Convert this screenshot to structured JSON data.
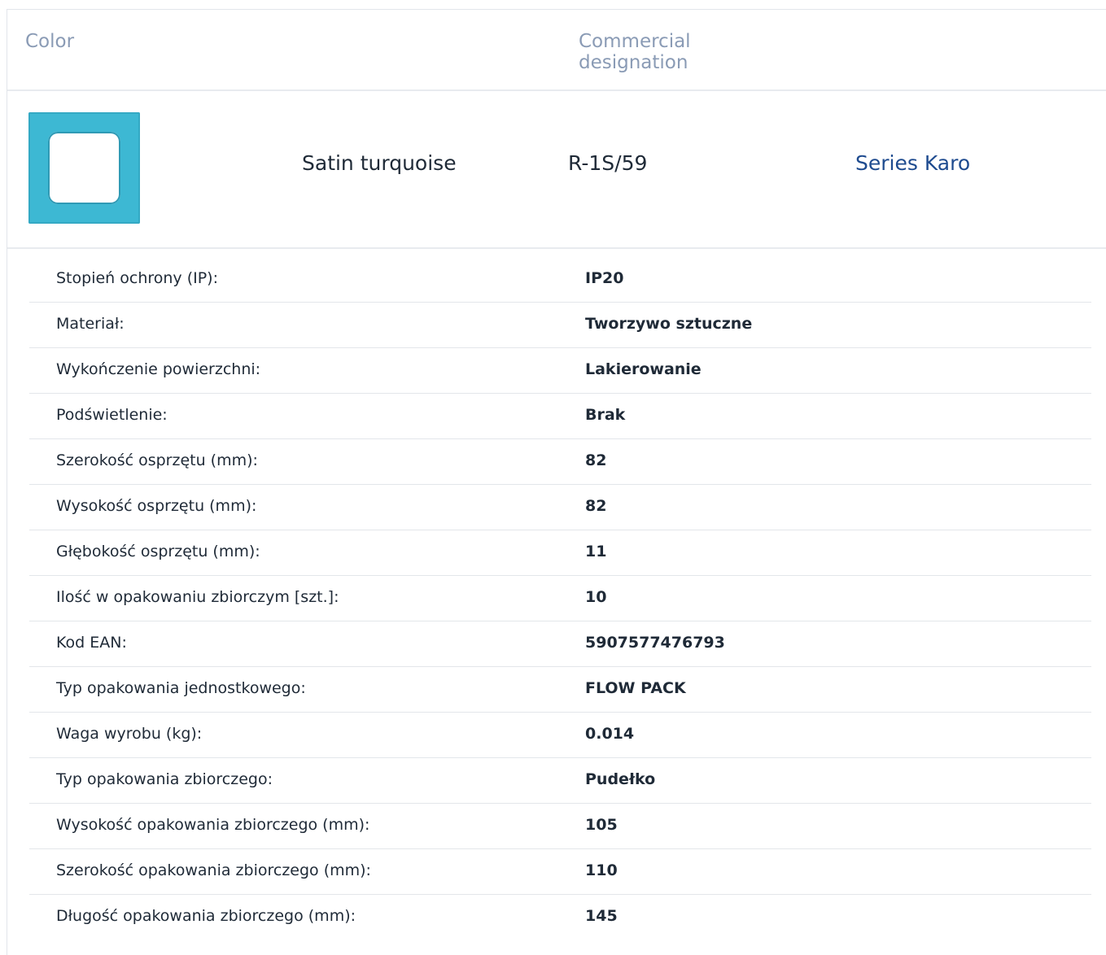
{
  "header": {
    "color_label": "Color",
    "commercial_label": "Commercial designation"
  },
  "product": {
    "swatch_color": "#3db8d3",
    "color_name": "Satin turquoise",
    "code": "R-1S/59",
    "series_link": "Series Karo"
  },
  "specs": [
    {
      "label": "Stopień ochrony (IP):",
      "value": "IP20"
    },
    {
      "label": "Materiał:",
      "value": "Tworzywo sztuczne"
    },
    {
      "label": "Wykończenie powierzchni:",
      "value": "Lakierowanie"
    },
    {
      "label": "Podświetlenie:",
      "value": "Brak"
    },
    {
      "label": "Szerokość osprzętu (mm):",
      "value": "82"
    },
    {
      "label": "Wysokość osprzętu (mm):",
      "value": "82"
    },
    {
      "label": "Głębokość osprzętu (mm):",
      "value": "11"
    },
    {
      "label": "Ilość w opakowaniu zbiorczym [szt.]:",
      "value": "10"
    },
    {
      "label": "Kod EAN:",
      "value": "5907577476793"
    },
    {
      "label": "Typ opakowania jednostkowego:",
      "value": "FLOW PACK"
    },
    {
      "label": "Waga wyrobu (kg):",
      "value": "0.014"
    },
    {
      "label": "Typ opakowania zbiorczego:",
      "value": "Pudełko"
    },
    {
      "label": "Wysokość opakowania zbiorczego (mm):",
      "value": "105"
    },
    {
      "label": "Szerokość opakowania zbiorczego (mm):",
      "value": "110"
    },
    {
      "label": "Długość opakowania zbiorczego (mm):",
      "value": "145"
    }
  ]
}
